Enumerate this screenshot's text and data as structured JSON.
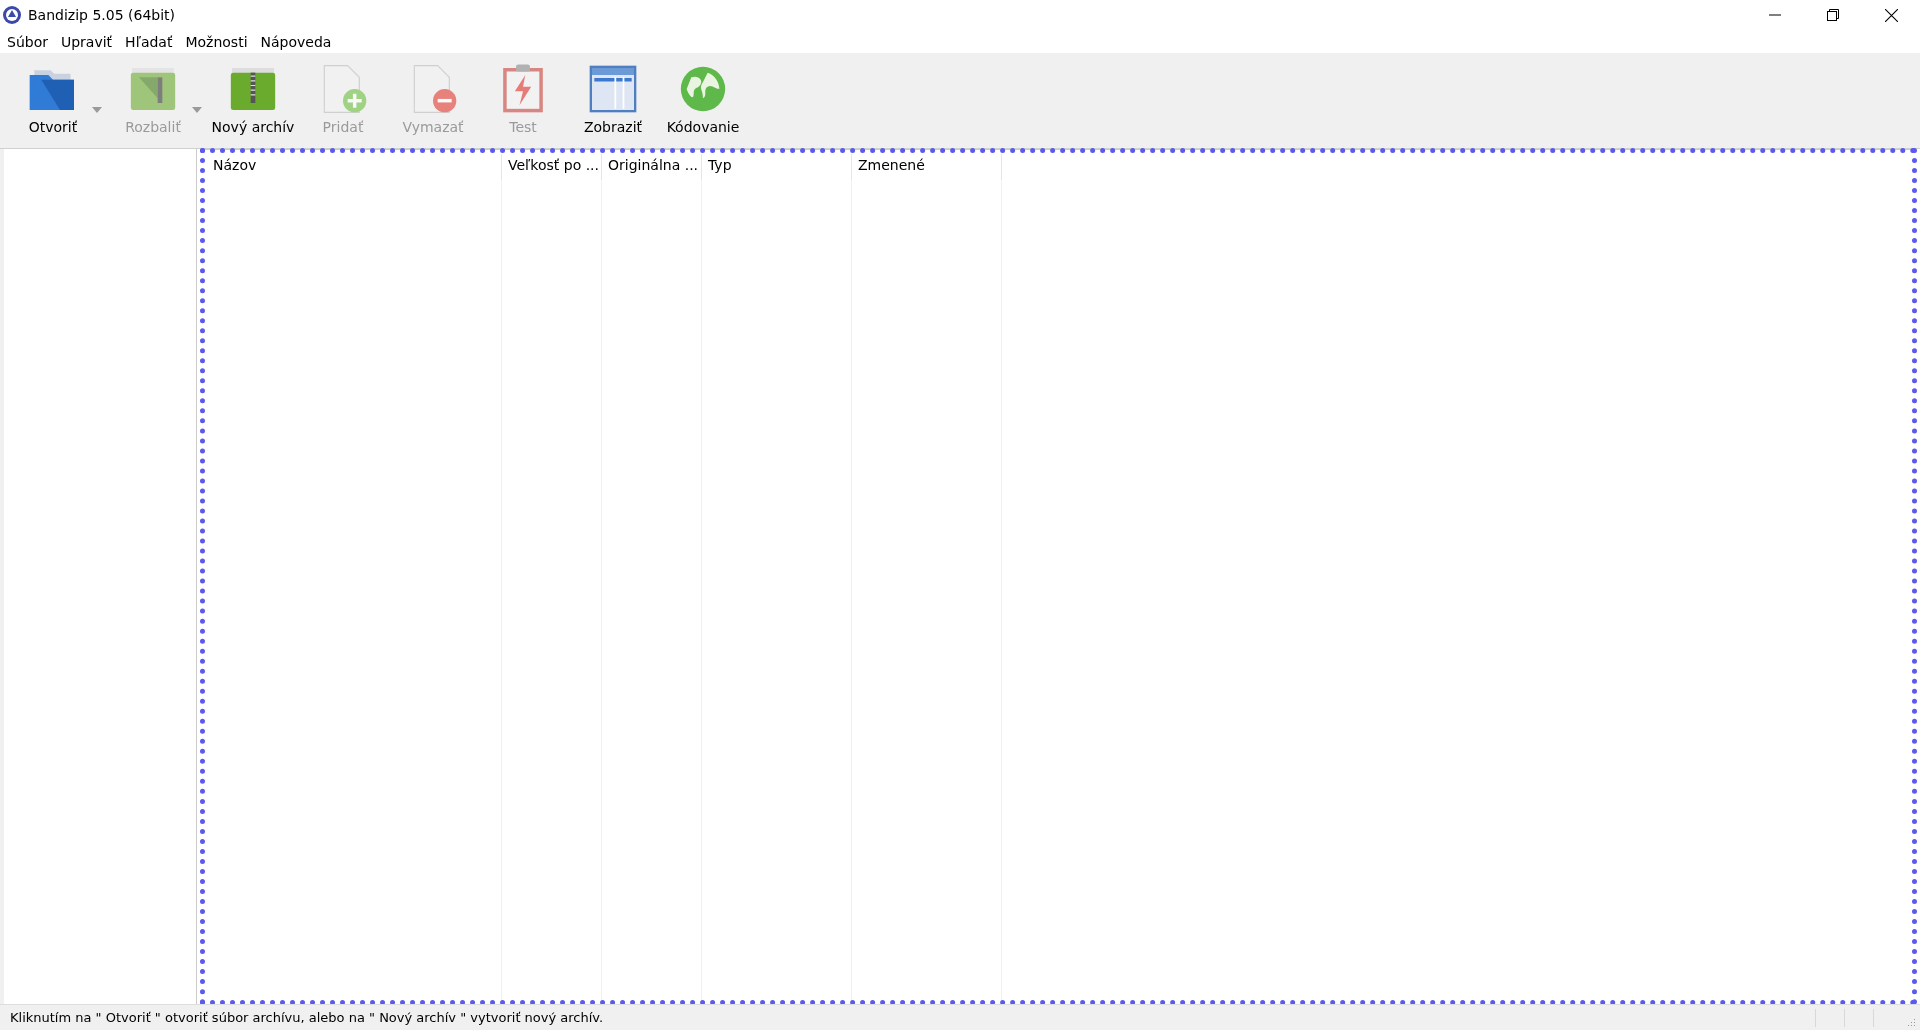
{
  "window": {
    "title": "Bandizip 5.05 (64bit)"
  },
  "menu": [
    {
      "label": "Súbor"
    },
    {
      "label": "Upraviť"
    },
    {
      "label": "Hľadať"
    },
    {
      "label": "Možnosti"
    },
    {
      "label": "Nápoveda"
    }
  ],
  "toolbar": [
    {
      "kind": "open",
      "label": "Otvoriť",
      "disabled": false,
      "dropdown": true
    },
    {
      "kind": "extract",
      "label": "Rozbaliť",
      "disabled": true,
      "dropdown": true
    },
    {
      "kind": "new",
      "label": "Nový archív",
      "disabled": false,
      "dropdown": false
    },
    {
      "kind": "add",
      "label": "Pridať",
      "disabled": true,
      "dropdown": false
    },
    {
      "kind": "delete",
      "label": "Vymazať",
      "disabled": true,
      "dropdown": false
    },
    {
      "kind": "test",
      "label": "Test",
      "disabled": true,
      "dropdown": false
    },
    {
      "kind": "view",
      "label": "Zobraziť",
      "disabled": false,
      "dropdown": false
    },
    {
      "kind": "encoding",
      "label": "Kódovanie",
      "disabled": false,
      "dropdown": false
    }
  ],
  "table": {
    "columns": [
      "Názov",
      "Veľkosť po ...",
      "Originálna ...",
      "Typ",
      "Zmenené"
    ]
  },
  "status_bar": {
    "text": "Kliknutím na \" Otvoriť \" otvoriť súbor archívu, alebo na \" Nový archív \" vytvoriť nový archív."
  }
}
